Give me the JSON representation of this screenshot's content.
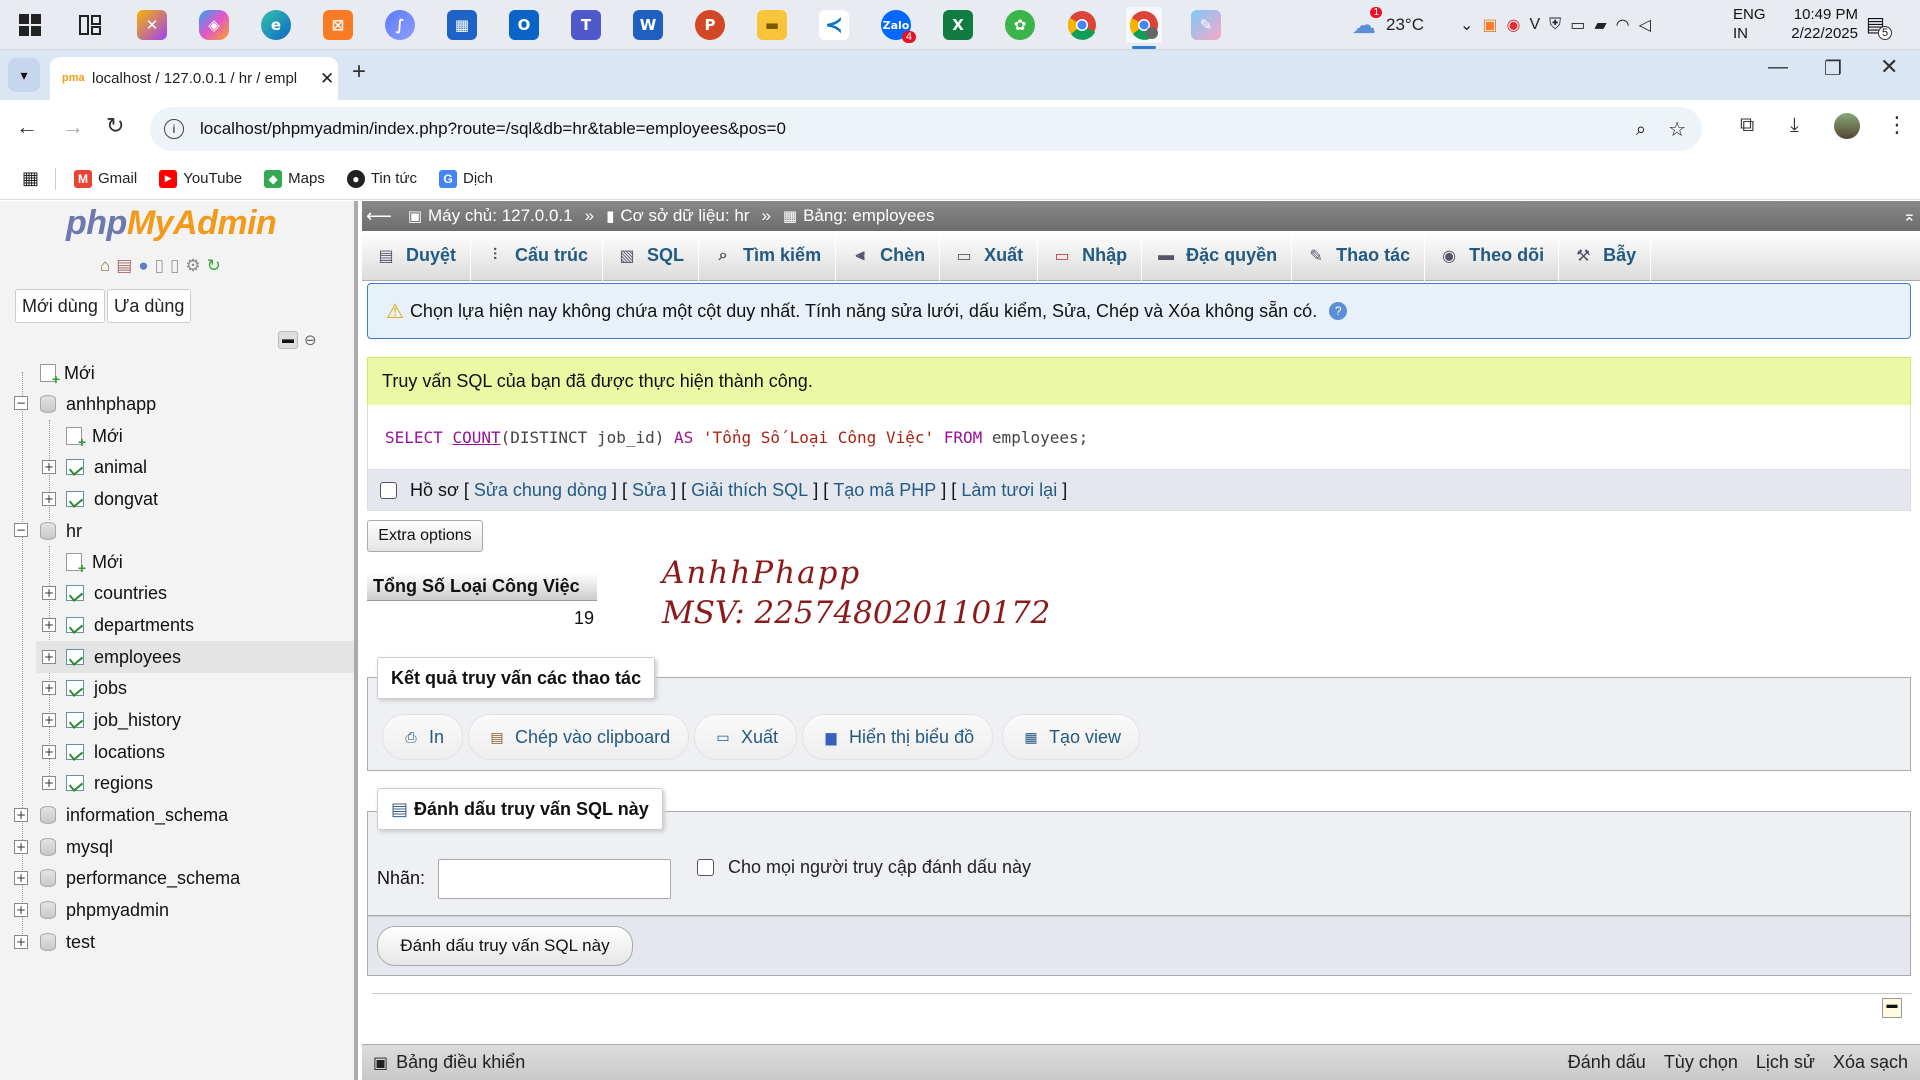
{
  "taskbar": {
    "icons": [
      "windows-start-icon",
      "task-view-icon",
      "app-icon-1",
      "copilot-icon",
      "edge-icon",
      "xampp-icon",
      "app-icon-2",
      "store-icon",
      "outlook-icon",
      "teams-icon",
      "word-icon",
      "powerpoint-icon",
      "file-explorer-icon",
      "vscode-icon",
      "zalo-icon",
      "excel-icon",
      "app-icon-3",
      "chrome-icon",
      "chrome-profile-icon",
      "paint-icon"
    ],
    "zalo_badge": "4",
    "weather_badge": "1",
    "temperature": "23°C",
    "lang_top": "ENG",
    "lang_bottom": "IN",
    "time": "10:49 PM",
    "date": "2/22/2025",
    "notif_count": "5"
  },
  "browser": {
    "tab_title": "localhost / 127.0.0.1 / hr / empl",
    "url": "localhost/phpmyadmin/index.php?route=/sql&db=hr&table=employees&pos=0",
    "bookmarks": [
      {
        "label": "Gmail",
        "color": "#ea4335",
        "glyph": "M"
      },
      {
        "label": "YouTube",
        "color": "#ff0000",
        "glyph": "▶"
      },
      {
        "label": "Maps",
        "color": "#34a853",
        "glyph": "◆"
      },
      {
        "label": "Tin tức",
        "color": "#222222",
        "glyph": "●"
      },
      {
        "label": "Dịch",
        "color": "#4285f4",
        "glyph": "G"
      }
    ]
  },
  "sidebar": {
    "logo_php": "php",
    "logo_myadmin": "MyAdmin",
    "btn_recent": "Mới dùng",
    "btn_favorite": "Ưa dùng",
    "tree": {
      "new": "Mới",
      "anhhphapp": "anhhphapp",
      "anhhphapp_new": "Mới",
      "animal": "animal",
      "dongvat": "dongvat",
      "hr": "hr",
      "hr_new": "Mới",
      "countries": "countries",
      "departments": "departments",
      "employees": "employees",
      "jobs": "jobs",
      "job_history": "job_history",
      "locations": "locations",
      "regions": "regions",
      "information_schema": "information_schema",
      "mysql": "mysql",
      "performance_schema": "performance_schema",
      "phpmyadmin": "phpmyadmin",
      "test": "test"
    }
  },
  "breadcrumb": {
    "server": "Máy chủ: 127.0.0.1",
    "database": "Cơ sở dữ liệu: hr",
    "table": "Bảng: employees"
  },
  "tabs": {
    "browse": "Duyệt",
    "structure": "Cấu trúc",
    "sql": "SQL",
    "search": "Tìm kiếm",
    "insert": "Chèn",
    "export": "Xuất",
    "import": "Nhập",
    "privileges": "Đặc quyền",
    "operations": "Thao tác",
    "tracking": "Theo dõi",
    "triggers": "Bẫy"
  },
  "notice": "Chọn lựa hiện nay không chứa một cột duy nhất. Tính năng sửa lưới, dấu kiểm, Sửa, Chép và Xóa không sẵn có.",
  "success": "Truy vấn SQL của bạn đã được thực hiện thành công.",
  "sql": {
    "select": "SELECT",
    "count": "COUNT",
    "args": "(DISTINCT job_id)",
    "as": "AS",
    "alias": "'Tổng Số Loại Công Việc'",
    "from": "FROM",
    "table": "employees;"
  },
  "query_links": {
    "profiling": "Hồ sơ",
    "edit_inline": "Sửa chung dòng",
    "edit": "Sửa",
    "explain": "Giải thích SQL",
    "php_code": "Tạo mã PHP",
    "refresh": "Làm tươi lại"
  },
  "extra_options": "Extra options",
  "result": {
    "column": "Tổng Số Loại Công Việc",
    "value": "19"
  },
  "watermark": {
    "line1": "AnhhPhapp",
    "line2": "MSV: 225748020110172"
  },
  "operations": {
    "legend": "Kết quả truy vấn các thao tác",
    "print": "In",
    "copy": "Chép vào clipboard",
    "export": "Xuất",
    "chart": "Hiển thị biểu đồ",
    "create_view": "Tạo view"
  },
  "bookmark": {
    "legend": "Đánh dấu truy vấn SQL này",
    "label": "Nhãn:",
    "label_value": "",
    "shared": "Cho mọi người truy cập đánh dấu này",
    "submit": "Đánh dấu truy vấn SQL này"
  },
  "bottombar": {
    "console": "Bảng điều khiển",
    "bookmarks": "Đánh dấu",
    "options": "Tùy chọn",
    "history": "Lịch sử",
    "clear": "Xóa sạch"
  },
  "colors": {
    "link": "#235a81",
    "notice_bg": "#e8f0fa",
    "success_bg": "#ebf8a4",
    "watermark": "#8b1a1a"
  }
}
